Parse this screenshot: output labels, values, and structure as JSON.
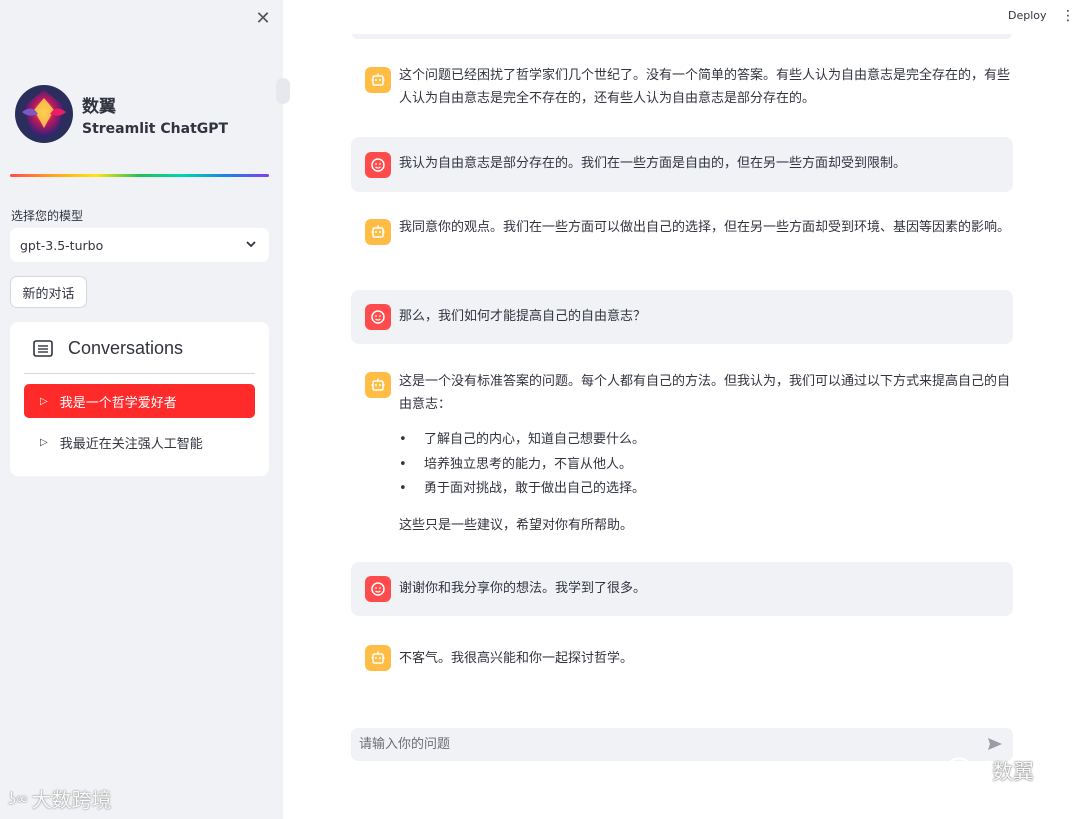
{
  "sidebar": {
    "brand_name": "数翼",
    "brand_subtitle": "Streamlit ChatGPT",
    "model_label": "选择您的模型",
    "model_value": "gpt-3.5-turbo",
    "new_chat_label": "新的对话",
    "conversations_title": "Conversations",
    "conversations": [
      {
        "label": "我是一个哲学爱好者",
        "active": true
      },
      {
        "label": "我最近在关注强人工智能",
        "active": false
      }
    ],
    "watermark": "大数跨境"
  },
  "header": {
    "deploy_label": "Deploy",
    "menu_icon": "⋮"
  },
  "messages": [
    {
      "role": "assistant",
      "text": "这个问题已经困扰了哲学家们几个世纪了。没有一个简单的答案。有些人认为自由意志是完全存在的，有些人认为自由意志是完全不存在的，还有些人认为自由意志是部分存在的。"
    },
    {
      "role": "user",
      "text": "我认为自由意志是部分存在的。我们在一些方面是自由的，但在另一些方面却受到限制。"
    },
    {
      "role": "assistant",
      "text": "我同意你的观点。我们在一些方面可以做出自己的选择，但在另一些方面却受到环境、基因等因素的影响。"
    },
    {
      "role": "user",
      "text": "那么，我们如何才能提高自己的自由意志？"
    },
    {
      "role": "assistant",
      "intro": "这是一个没有标准答案的问题。每个人都有自己的方法。但我认为，我们可以通过以下方式来提高自己的自由意志：",
      "bullets": [
        "了解自己的内心，知道自己想要什么。",
        "培养独立思考的能力，不盲从他人。",
        "勇于面对挑战，敢于做出自己的选择。"
      ],
      "outro": "这些只是一些建议，希望对你有所帮助。"
    },
    {
      "role": "user",
      "text": "谢谢你和我分享你的想法。我学到了很多。"
    },
    {
      "role": "assistant",
      "text": "不客气。我很高兴能和你一起探讨哲学。"
    }
  ],
  "input": {
    "placeholder": "请输入你的问题"
  },
  "watermark_right": "数翼",
  "colors": {
    "accent": "#ff2b2b",
    "user_avatar": "#ff4b4b",
    "bot_avatar": "#ffbd45",
    "sidebar_bg": "#f0f2f6"
  }
}
